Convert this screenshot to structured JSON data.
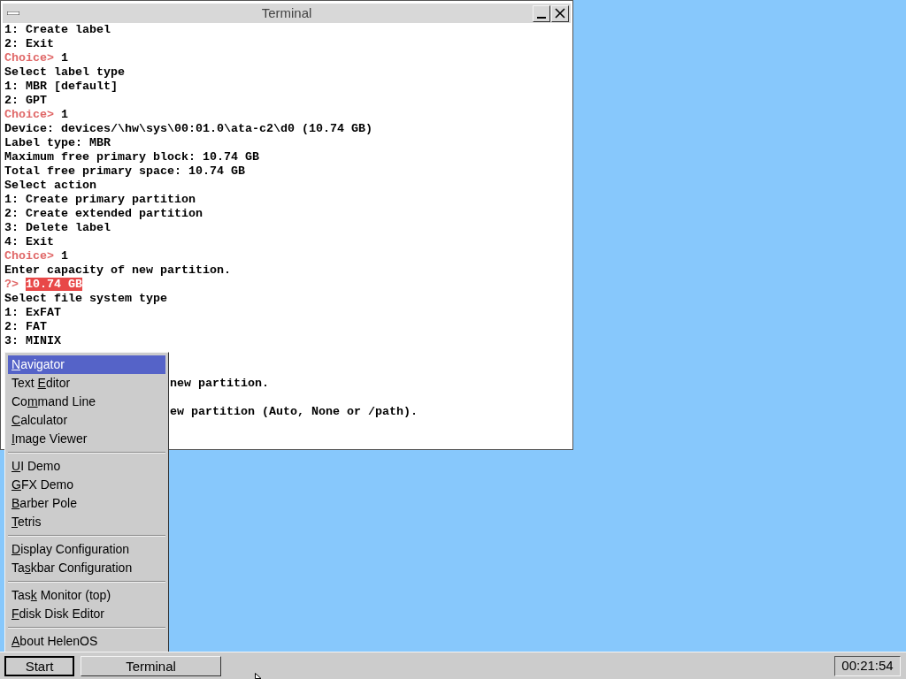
{
  "window": {
    "title": "Terminal",
    "lines": [
      {
        "kind": "text",
        "segments": [
          {
            "kind": "plain",
            "text": "1: Create label"
          }
        ]
      },
      {
        "kind": "text",
        "segments": [
          {
            "kind": "plain",
            "text": "2: Exit"
          }
        ]
      },
      {
        "kind": "text",
        "segments": [
          {
            "kind": "prompt",
            "text": "Choice>"
          },
          {
            "kind": "plain",
            "text": " 1"
          }
        ]
      },
      {
        "kind": "text",
        "segments": [
          {
            "kind": "plain",
            "text": "Select label type"
          }
        ]
      },
      {
        "kind": "text",
        "segments": [
          {
            "kind": "plain",
            "text": "1: MBR [default]"
          }
        ]
      },
      {
        "kind": "text",
        "segments": [
          {
            "kind": "plain",
            "text": "2: GPT"
          }
        ]
      },
      {
        "kind": "text",
        "segments": [
          {
            "kind": "prompt",
            "text": "Choice>"
          },
          {
            "kind": "plain",
            "text": " 1"
          }
        ]
      },
      {
        "kind": "text",
        "segments": [
          {
            "kind": "plain",
            "text": "Device: devices/\\hw\\sys\\00:01.0\\ata-c2\\d0 (10.74 GB)"
          }
        ]
      },
      {
        "kind": "text",
        "segments": [
          {
            "kind": "plain",
            "text": "Label type: MBR"
          }
        ]
      },
      {
        "kind": "text",
        "segments": [
          {
            "kind": "plain",
            "text": "Maximum free primary block: 10.74 GB"
          }
        ]
      },
      {
        "kind": "text",
        "segments": [
          {
            "kind": "plain",
            "text": "Total free primary space: 10.74 GB"
          }
        ]
      },
      {
        "kind": "text",
        "segments": [
          {
            "kind": "plain",
            "text": "Select action"
          }
        ]
      },
      {
        "kind": "text",
        "segments": [
          {
            "kind": "plain",
            "text": "1: Create primary partition"
          }
        ]
      },
      {
        "kind": "text",
        "segments": [
          {
            "kind": "plain",
            "text": "2: Create extended partition"
          }
        ]
      },
      {
        "kind": "text",
        "segments": [
          {
            "kind": "plain",
            "text": "3: Delete label"
          }
        ]
      },
      {
        "kind": "text",
        "segments": [
          {
            "kind": "plain",
            "text": "4: Exit"
          }
        ]
      },
      {
        "kind": "text",
        "segments": [
          {
            "kind": "prompt",
            "text": "Choice>"
          },
          {
            "kind": "plain",
            "text": " 1"
          }
        ]
      },
      {
        "kind": "text",
        "segments": [
          {
            "kind": "plain",
            "text": "Enter capacity of new partition."
          }
        ]
      },
      {
        "kind": "text",
        "segments": [
          {
            "kind": "prompt",
            "text": "?>"
          },
          {
            "kind": "highlight",
            "text": "10.74 GB"
          }
        ]
      },
      {
        "kind": "text",
        "segments": [
          {
            "kind": "plain",
            "text": "Select file system type"
          }
        ]
      },
      {
        "kind": "text",
        "segments": [
          {
            "kind": "plain",
            "text": "1: ExFAT"
          }
        ]
      },
      {
        "kind": "text",
        "segments": [
          {
            "kind": "plain",
            "text": "2: FAT"
          }
        ]
      },
      {
        "kind": "text",
        "segments": [
          {
            "kind": "plain",
            "text": "3: MINIX"
          }
        ]
      },
      {
        "kind": "blank"
      },
      {
        "kind": "blank"
      },
      {
        "kind": "partial",
        "segments": [
          {
            "kind": "plain",
            "text": "new partition."
          }
        ]
      },
      {
        "kind": "blank"
      },
      {
        "kind": "partial",
        "segments": [
          {
            "kind": "plain",
            "text": "ew partition (Auto, None or /path)."
          }
        ]
      }
    ]
  },
  "start_menu": {
    "groups": [
      [
        {
          "key": "N",
          "after": "avigator",
          "selected": true
        },
        {
          "before": "Text ",
          "key": "E",
          "after": "ditor",
          "selected": false
        },
        {
          "before": "Co",
          "key": "m",
          "after": "mand Line",
          "selected": false
        },
        {
          "key": "C",
          "after": "alculator",
          "selected": false
        },
        {
          "key": "I",
          "after": "mage Viewer",
          "selected": false
        }
      ],
      [
        {
          "key": "U",
          "after": "I Demo",
          "selected": false
        },
        {
          "key": "G",
          "after": "FX Demo",
          "selected": false
        },
        {
          "key": "B",
          "after": "arber Pole",
          "selected": false
        },
        {
          "key": "T",
          "after": "etris",
          "selected": false
        }
      ],
      [
        {
          "key": "D",
          "after": "isplay Configuration",
          "selected": false
        },
        {
          "before": "Ta",
          "key": "s",
          "after": "kbar Configuration",
          "selected": false
        }
      ],
      [
        {
          "before": "Tas",
          "key": "k",
          "after": " Monitor (top)",
          "selected": false
        },
        {
          "key": "F",
          "after": "disk Disk Editor",
          "selected": false
        }
      ],
      [
        {
          "key": "A",
          "after": "bout HelenOS",
          "selected": false
        }
      ]
    ]
  },
  "taskbar": {
    "start": "Start",
    "tasks": [
      "Terminal"
    ],
    "clock": "00:21:54"
  }
}
